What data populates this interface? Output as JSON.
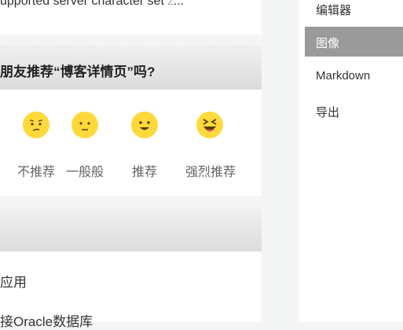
{
  "top_card": {
    "text": "upported server character set ",
    "cut": "Z",
    "ellipsis": "..."
  },
  "recommend": {
    "question": "朋友推荐“博客详情页”吗?",
    "options": [
      {
        "label": "不推荐",
        "icon": "confused-face-icon"
      },
      {
        "label": "一般般",
        "icon": "neutral-face-icon"
      },
      {
        "label": "推荐",
        "icon": "smiling-face-icon"
      },
      {
        "label": "强烈推荐",
        "icon": "laughing-face-icon"
      }
    ],
    "emoji_color": "#ffd93b"
  },
  "bottom_list": {
    "items": [
      "应用",
      "接Oracle数据库"
    ]
  },
  "menu": {
    "items": [
      "编辑器",
      "图像",
      "Markdown",
      "导出"
    ],
    "active_index": 1,
    "active_color": "#9a9a9a"
  }
}
